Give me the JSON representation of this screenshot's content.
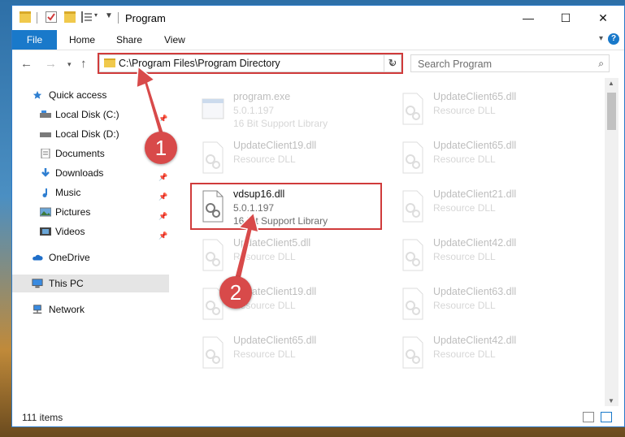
{
  "window": {
    "title": "Program",
    "controls": {
      "minimize": "—",
      "maximize": "☐",
      "close": "✕"
    }
  },
  "ribbon": {
    "tabs": [
      "File",
      "Home",
      "Share",
      "View"
    ],
    "help": "?"
  },
  "nav": {
    "address": "C:\\Program Files\\Program Directory",
    "search_placeholder": "Search Program"
  },
  "sidebar": {
    "items": [
      {
        "label": "Quick access",
        "icon": "star-icon",
        "color": "#2f7fd1"
      },
      {
        "label": "Local Disk (C:)",
        "icon": "drive-icon",
        "pinned": true
      },
      {
        "label": "Local Disk (D:)",
        "icon": "drive-icon",
        "pinned": true
      },
      {
        "label": "Documents",
        "icon": "documents-icon",
        "pinned": true
      },
      {
        "label": "Downloads",
        "icon": "download-icon",
        "pinned": true
      },
      {
        "label": "Music",
        "icon": "music-icon",
        "pinned": true
      },
      {
        "label": "Pictures",
        "icon": "pictures-icon",
        "pinned": true
      },
      {
        "label": "Videos",
        "icon": "videos-icon",
        "pinned": true
      },
      {
        "label": "OneDrive",
        "icon": "cloud-icon"
      },
      {
        "label": "This PC",
        "icon": "computer-icon",
        "selected": true
      },
      {
        "label": "Network",
        "icon": "network-icon"
      }
    ]
  },
  "files": {
    "left": [
      {
        "name": "program.exe",
        "line1": "5.0.1.197",
        "line2": "16 Bit Support Library",
        "faded": true
      },
      {
        "name": "UpdateClient19.dll",
        "line1": "Resource DLL",
        "line2": "",
        "faded": true
      },
      {
        "name": "vdsup16.dll",
        "line1": "5.0.1.197",
        "line2": "16 Bit Support Library",
        "faded": false
      },
      {
        "name": "UpdateClient5.dll",
        "line1": "Resource DLL",
        "line2": "",
        "faded": true
      },
      {
        "name": "UpdateClient19.dll",
        "line1": "Resource DLL",
        "line2": "",
        "faded": true
      },
      {
        "name": "UpdateClient65.dll",
        "line1": "Resource DLL",
        "line2": "",
        "faded": true
      }
    ],
    "right": [
      {
        "name": "UpdateClient65.dll",
        "line1": "Resource DLL"
      },
      {
        "name": "UpdateClient65.dll",
        "line1": "Resource DLL"
      },
      {
        "name": "UpdateClient21.dll",
        "line1": "Resource DLL"
      },
      {
        "name": "UpdateClient42.dll",
        "line1": "Resource DLL"
      },
      {
        "name": "UpdateClient63.dll",
        "line1": "Resource DLL"
      },
      {
        "name": "UpdateClient42.dll",
        "line1": "Resource DLL"
      }
    ]
  },
  "status": {
    "count": "111 items"
  },
  "annotations": {
    "badges": [
      "1",
      "2"
    ],
    "color": "#d84a4a"
  }
}
